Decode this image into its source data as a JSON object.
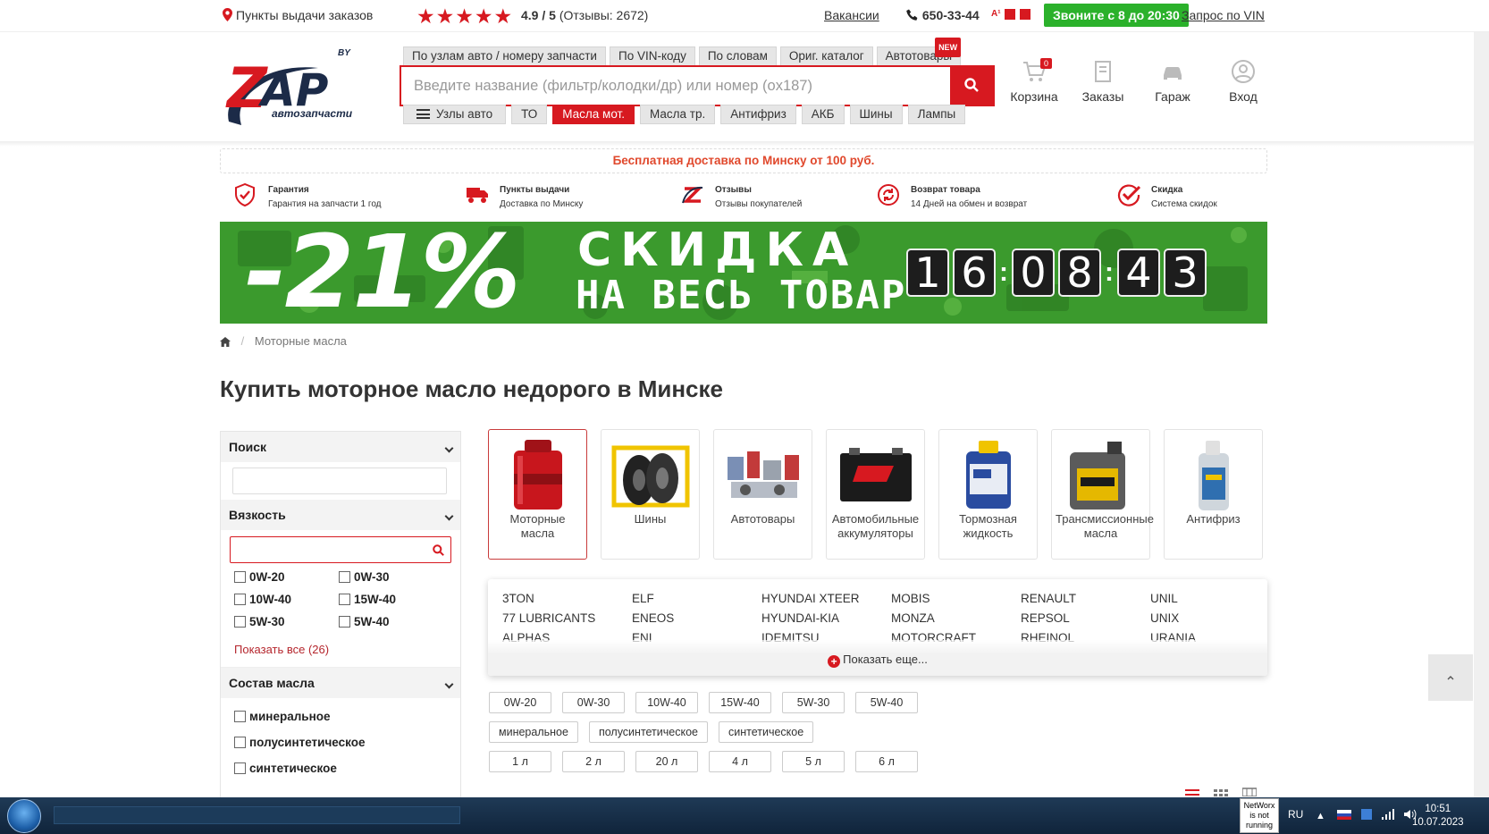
{
  "topbar": {
    "pickup": "Пункты выдачи заказов",
    "stars": "★★★★★",
    "rating_value": "4.9 / 5",
    "rating_reviews": "(Отзывы: 2672)",
    "vacancies": "Вакансии",
    "phone": "650-33-44",
    "hours_button": "Звоните с 8 до 20:30",
    "vin_request": "Запрос по VIN"
  },
  "header": {
    "search_tabs": [
      "По узлам авто / номеру запчасти",
      "По VIN-коду",
      "По словам",
      "Ориг. каталог",
      "Автотовары"
    ],
    "new_badge": "NEW",
    "search_placeholder": "Введите название (фильтр/колодки/др) или номер (ox187)",
    "quick_tabs": [
      "Узлы авто",
      "ТО",
      "Масла мот.",
      "Масла тр.",
      "Антифриз",
      "АКБ",
      "Шины",
      "Лампы"
    ],
    "cart_label": "Корзина",
    "cart_count": "0",
    "orders_label": "Заказы",
    "garage_label": "Гараж",
    "login_label": "Вход",
    "logo_by": "BY",
    "logo_text": "автозапчасти"
  },
  "delivery_note": "Бесплатная доставка по Минску от 100 руб.",
  "features": [
    {
      "title": "Гарантия",
      "sub": "Гарантия на запчасти 1 год"
    },
    {
      "title": "Пункты выдачи",
      "sub": "Доставка по Минску"
    },
    {
      "title": "Отзывы",
      "sub": "Отзывы покупателей"
    },
    {
      "title": "Возврат товара",
      "sub": "14 Дней на обмен и возврат"
    },
    {
      "title": "Скидка",
      "sub": "Система скидок"
    }
  ],
  "banner": {
    "percent": "-21%",
    "line1": "СКИДКА",
    "line2": "НА ВЕСЬ ТОВАР",
    "timer": [
      "1",
      "6",
      "0",
      "8",
      "4",
      "3"
    ]
  },
  "breadcrumb": {
    "current": "Моторные масла"
  },
  "page_title": "Купить моторное масло недорого в Минске",
  "sidebar": {
    "search_title": "Поиск",
    "viscosity_title": "Вязкость",
    "viscosity": [
      "0W-20",
      "0W-30",
      "10W-40",
      "15W-40",
      "5W-30",
      "5W-40"
    ],
    "show_all": "Показать все (26)",
    "composition_title": "Состав масла",
    "composition": [
      "минеральное",
      "полусинтетическое",
      "синтетическое"
    ]
  },
  "categories": [
    {
      "l1": "Моторные",
      "l2": "масла"
    },
    {
      "l1": "Шины",
      "l2": ""
    },
    {
      "l1": "Автотовары",
      "l2": ""
    },
    {
      "l1": "Автомобильные",
      "l2": "аккумуляторы"
    },
    {
      "l1": "Тормозная",
      "l2": "жидкость"
    },
    {
      "l1": "Трансмиссионные",
      "l2": "масла"
    },
    {
      "l1": "Антифриз",
      "l2": ""
    }
  ],
  "brands": [
    "3TON",
    "ELF",
    "HYUNDAI XTEER",
    "MOBIS",
    "RENAULT",
    "UNIL",
    "77 LUBRICANTS",
    "ENEOS",
    "HYUNDAI-KIA",
    "MONZA",
    "REPSOL",
    "UNIX",
    "ALPHAS",
    "ENI",
    "IDEMITSU",
    "MOTORCRAFT",
    "RHEINOL",
    "URANIA"
  ],
  "show_more": "Показать еще...",
  "chips": {
    "viscosity": [
      "0W-20",
      "0W-30",
      "10W-40",
      "15W-40",
      "5W-30",
      "5W-40"
    ],
    "composition": [
      "минеральное",
      "полусинтетическое",
      "синтетическое"
    ],
    "volume": [
      "1 л",
      "2 л",
      "20 л",
      "4 л",
      "5 л",
      "6 л"
    ]
  },
  "taskbar": {
    "networx": "NetWorx is not running",
    "lang": "RU",
    "time": "10:51",
    "date": "10.07.2023"
  },
  "colors": {
    "accent": "#d71920",
    "green": "#2bb12b"
  }
}
